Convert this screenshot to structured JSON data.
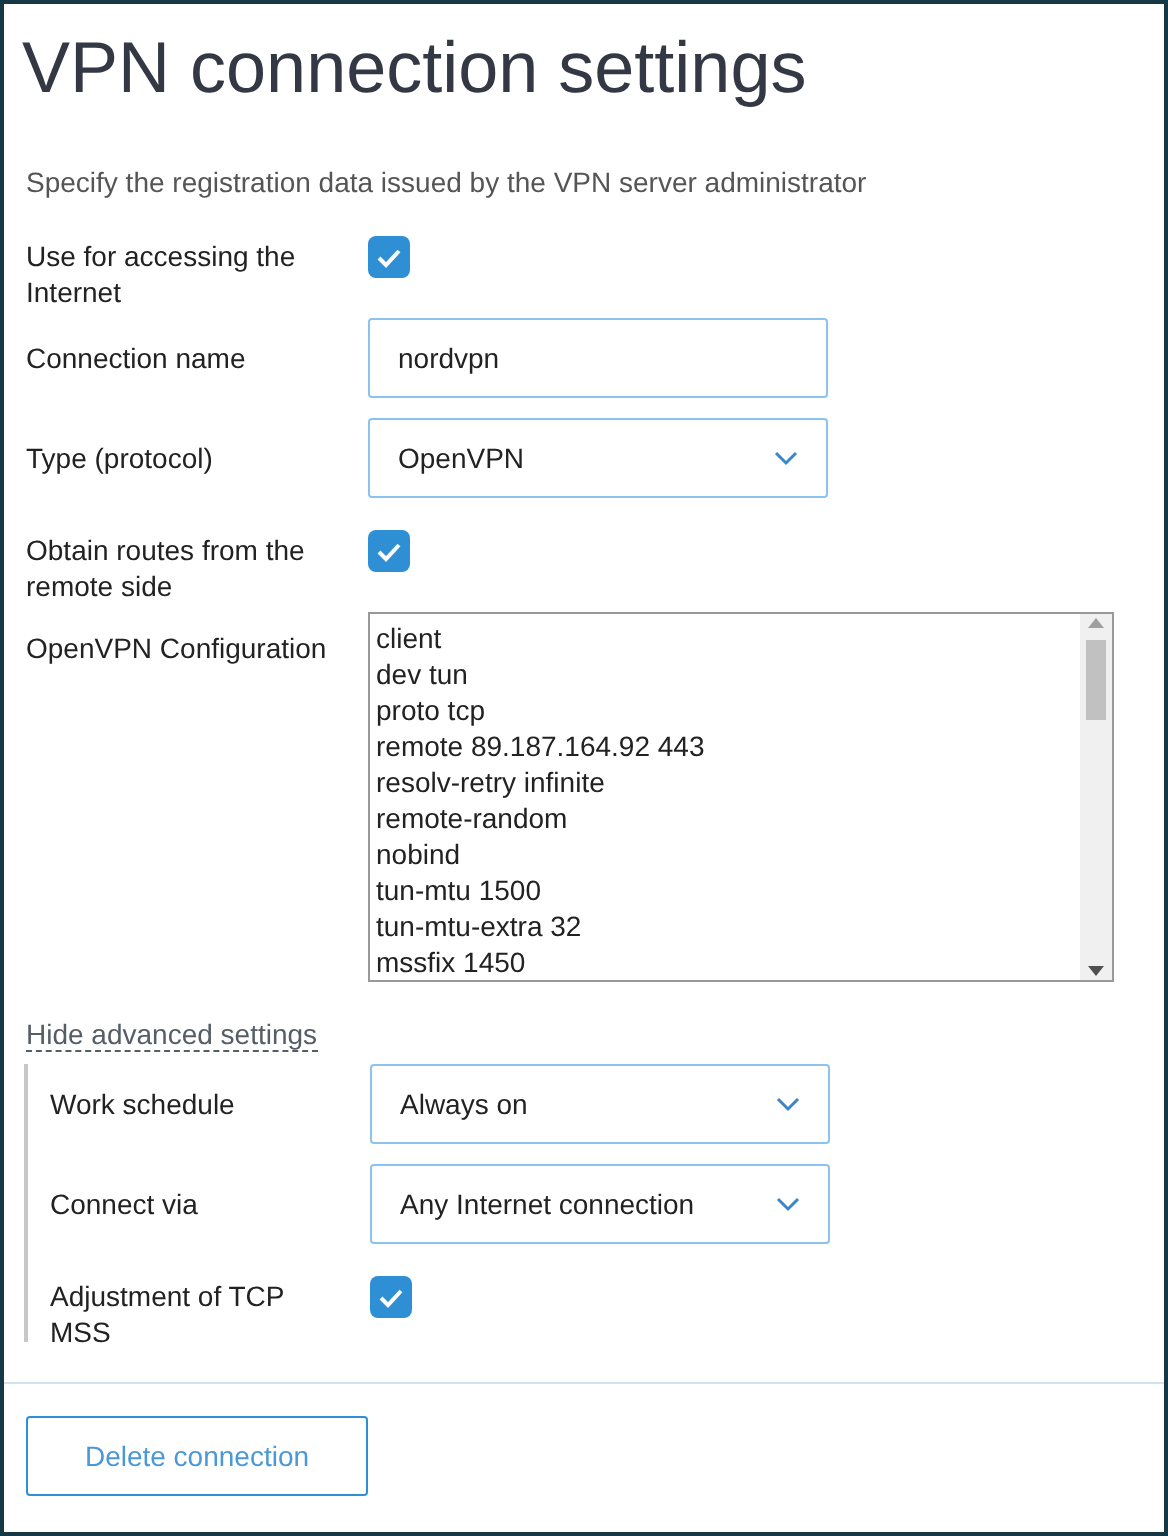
{
  "title": "VPN connection settings",
  "description": "Specify the registration data issued by the VPN server administrator",
  "fields": [
    {
      "kind": "checkbox",
      "label": "Use for accessing the Internet",
      "checked": true
    },
    {
      "kind": "text",
      "label": "Connection name",
      "value": "nordvpn"
    },
    {
      "kind": "select",
      "label": "Type (protocol)",
      "value": "OpenVPN"
    },
    {
      "kind": "checkbox",
      "label": "Obtain routes from the remote side",
      "checked": true
    },
    {
      "kind": "textarea",
      "label": "OpenVPN Configuration",
      "lines": [
        "client",
        "dev tun",
        "proto tcp",
        "remote 89.187.164.92 443",
        "resolv-retry infinite",
        "remote-random",
        "nobind",
        "tun-mtu 1500",
        "tun-mtu-extra 32",
        "mssfix 1450"
      ]
    }
  ],
  "advanced_toggle": "Hide advanced settings",
  "advanced_fields": [
    {
      "kind": "select",
      "label": "Work schedule",
      "value": "Always on"
    },
    {
      "kind": "select",
      "label": "Connect via",
      "value": "Any Internet connection"
    },
    {
      "kind": "checkbox",
      "label": "Adjustment of TCP MSS",
      "checked": true
    }
  ],
  "delete_button": "Delete connection"
}
